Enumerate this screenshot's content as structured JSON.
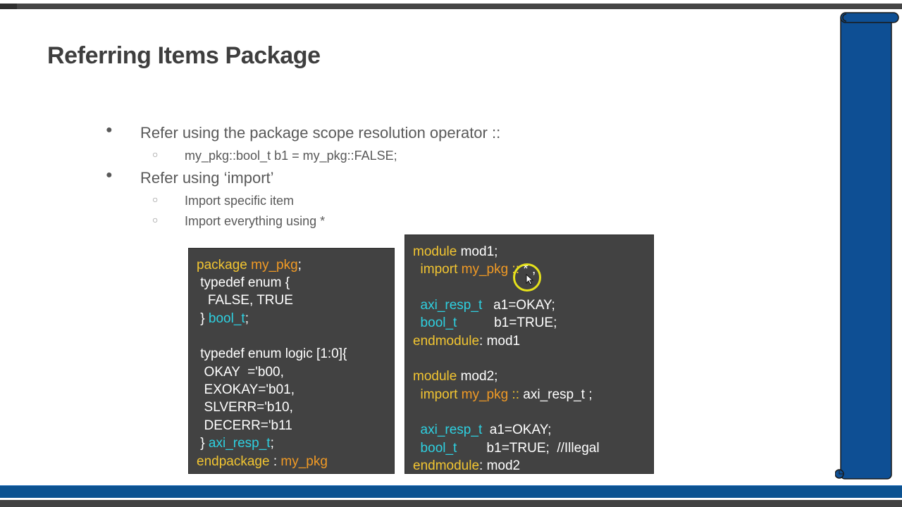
{
  "slide": {
    "title": "Referring Items Package",
    "bullets": [
      {
        "level": 1,
        "marker": "●",
        "text": "Refer using the package scope resolution operator ::"
      },
      {
        "level": 2,
        "marker": "○",
        "text": "my_pkg::bool_t  b1 = my_pkg::FALSE;"
      },
      {
        "level": 1,
        "marker": "●",
        "text": "Refer using ‘import’"
      },
      {
        "level": 2,
        "marker": "○",
        "text": "Import specific item"
      },
      {
        "level": 2,
        "marker": "○",
        "text": "Import everything using *"
      }
    ],
    "package_code": {
      "line1": {
        "kw": "package",
        "pkg": "my_pkg",
        "rest": ";"
      },
      "line2": {
        "pl": " typedef enum {"
      },
      "line3": {
        "pl": "   FALSE, TRUE"
      },
      "line4": {
        "pl": " } ",
        "ty": "bool_t",
        "rest": ";"
      },
      "line5": {
        "pl": " typedef enum logic [1:0]{"
      },
      "line6": {
        "pl": "  OKAY  ='b00,"
      },
      "line7": {
        "pl": "  EXOKAY='b01,"
      },
      "line8": {
        "pl": "  SLVERR='b10,"
      },
      "line9": {
        "pl": "  DECERR='b11"
      },
      "line10": {
        "pl": " } ",
        "ty": "axi_resp_t",
        "rest": ";"
      },
      "line11": {
        "kw": "endpackage",
        "sep": " : ",
        "pkg": "my_pkg"
      }
    },
    "module_code": {
      "m1_line1": {
        "kw": "module",
        "pl": " mod1;"
      },
      "m1_line2": {
        "kw": "  import ",
        "pkg": "my_pkg",
        "op": " :: ",
        "rest": "* ;"
      },
      "m1_line3": {
        "ty": "  axi_resp_t",
        "pl": "   a1=OKAY;"
      },
      "m1_line4": {
        "ty": "  bool_t",
        "pl": "          b1=TRUE;"
      },
      "m1_line5": {
        "kw": "endmodule",
        "pl": ": mod1"
      },
      "m2_line1": {
        "kw": "module",
        "pl": " mod2;"
      },
      "m2_line2": {
        "kw": "  import ",
        "pkg": "my_pkg",
        "op": " :: ",
        "rest": "axi_resp_t ;"
      },
      "m2_line3": {
        "ty": "  axi_resp_t",
        "pl": "  a1=OKAY;"
      },
      "m2_line4": {
        "ty": "  bool_t",
        "pl": "        b1=TRUE;  //Illegal"
      },
      "m2_line5": {
        "kw": "endmodule",
        "pl": ": mod2"
      }
    }
  },
  "colors": {
    "keyword": "#f2c531",
    "package_name": "#f19a25",
    "type_name": "#2ed0e0",
    "code_background": "#424242",
    "footer_blue": "#0c5291",
    "scroll_blue": "#0e4f94"
  }
}
